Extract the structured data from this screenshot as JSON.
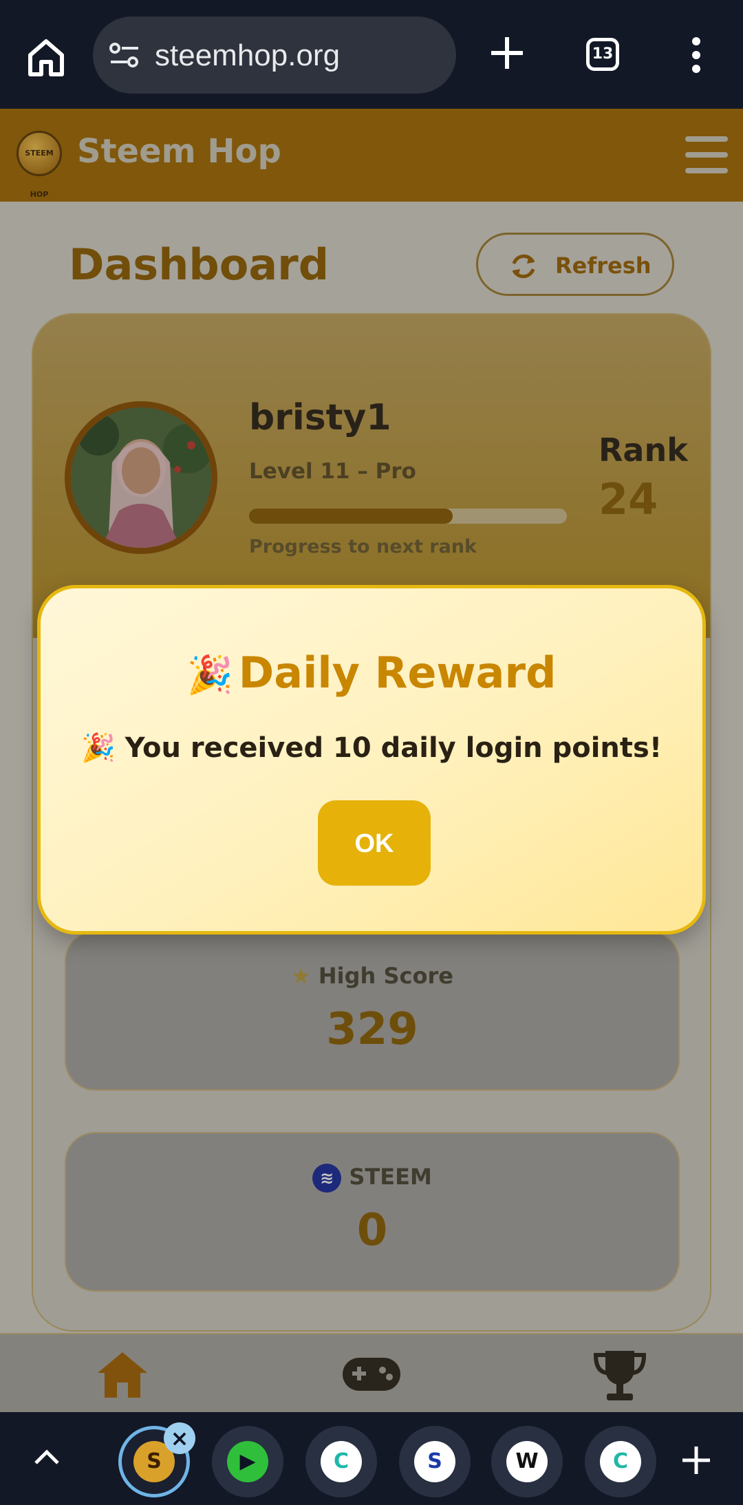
{
  "browser": {
    "url": "steemhop.org",
    "tab_count": "13"
  },
  "app": {
    "brand": "Steem Hop",
    "logo_text": "STEEM HOP"
  },
  "dashboard": {
    "title": "Dashboard",
    "refresh_label": "Refresh",
    "profile": {
      "username": "bristy1",
      "level": "Level 11 – Pro",
      "progress_label": "Progress to next rank",
      "progress_fraction": 0.64,
      "rank_label": "Rank",
      "rank_value": "24"
    },
    "stats": [
      {
        "icon": "star-icon",
        "label": "High Score",
        "value": "329"
      },
      {
        "icon": "steem-icon",
        "label": "STEEM",
        "value": "0"
      }
    ]
  },
  "modal": {
    "title": "Daily Reward",
    "title_emoji": "🎉",
    "message": "🎉 You received 10 daily login points!",
    "ok_label": "OK"
  },
  "tab_strip": {
    "tabs": [
      {
        "name": "steemhop",
        "letter": "S"
      },
      {
        "name": "green-app",
        "letter": "▶"
      },
      {
        "name": "chat-app",
        "letter": "C"
      },
      {
        "name": "steemit",
        "letter": "S"
      },
      {
        "name": "w-app",
        "letter": "W"
      },
      {
        "name": "chat-app-2",
        "letter": "C"
      }
    ]
  },
  "colors": {
    "accent": "#e6b20a",
    "header_bg": "#a26a00",
    "brand_text": "#c98600"
  }
}
